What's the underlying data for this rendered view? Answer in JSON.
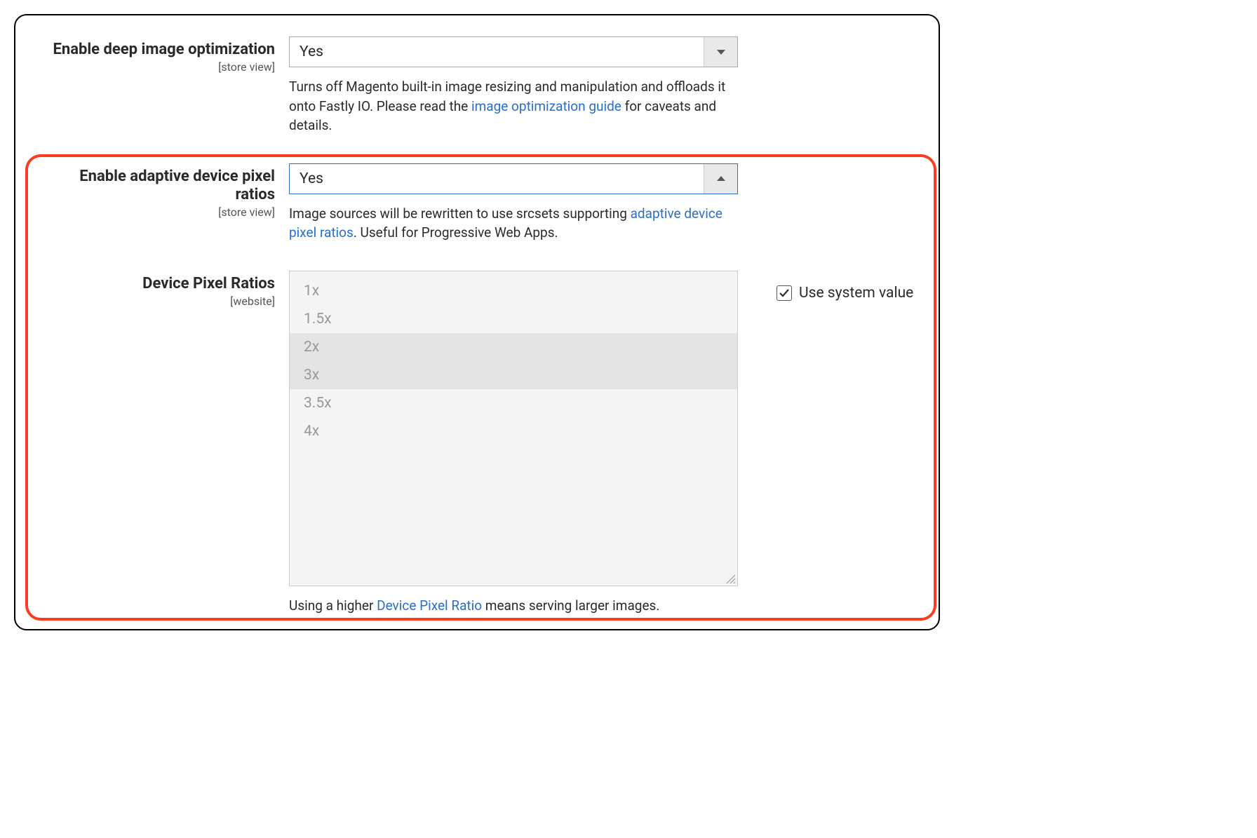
{
  "fields": {
    "deep_image_opt": {
      "label": "Enable deep image optimization",
      "scope": "[store view]",
      "value": "Yes",
      "help_pre": "Turns off Magento built-in image resizing and manipulation and offloads it onto Fastly IO. Please read the ",
      "help_link": "image optimization guide",
      "help_post": " for caveats and details."
    },
    "adaptive_dpr": {
      "label": "Enable adaptive device pixel ratios",
      "scope": "[store view]",
      "value": "Yes",
      "help_pre": "Image sources will be rewritten to use srcsets supporting ",
      "help_link": "adaptive device pixel ratios",
      "help_post": ". Useful for Progressive Web Apps."
    },
    "device_pixel_ratios": {
      "label": "Device Pixel Ratios",
      "scope": "[website]",
      "options": [
        {
          "label": "1x",
          "selected": false
        },
        {
          "label": "1.5x",
          "selected": false
        },
        {
          "label": "2x",
          "selected": true
        },
        {
          "label": "3x",
          "selected": true
        },
        {
          "label": "3.5x",
          "selected": false
        },
        {
          "label": "4x",
          "selected": false
        }
      ],
      "help_pre": "Using a higher ",
      "help_link": "Device Pixel Ratio",
      "help_post": " means serving larger images.",
      "use_system_value_label": "Use system value",
      "use_system_value_checked": true
    }
  }
}
